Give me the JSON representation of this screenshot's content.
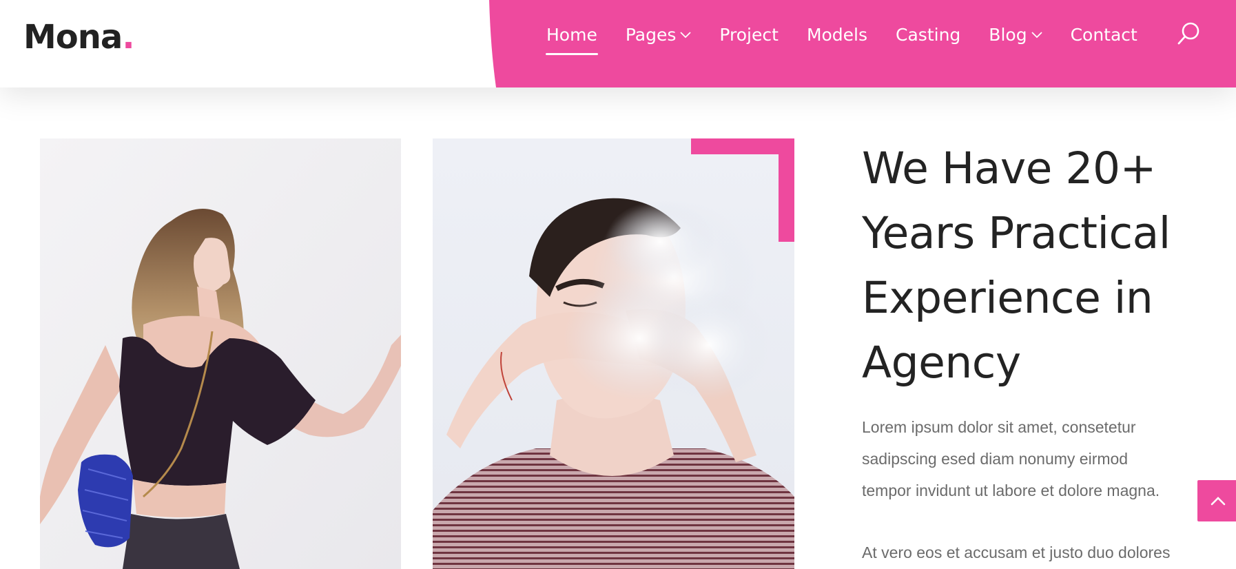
{
  "brand": {
    "name": "Mona",
    "dot": ".",
    "accent_color": "#ee4a9e"
  },
  "nav": {
    "items": [
      {
        "label": "Home",
        "active": true,
        "has_dropdown": false
      },
      {
        "label": "Pages",
        "active": false,
        "has_dropdown": true
      },
      {
        "label": "Project",
        "active": false,
        "has_dropdown": false
      },
      {
        "label": "Models",
        "active": false,
        "has_dropdown": false
      },
      {
        "label": "Casting",
        "active": false,
        "has_dropdown": false
      },
      {
        "label": "Blog",
        "active": false,
        "has_dropdown": true
      },
      {
        "label": "Contact",
        "active": false,
        "has_dropdown": false
      }
    ],
    "search_icon": "search-icon"
  },
  "about": {
    "heading_lines": [
      "We Have 20+",
      "Years Practical",
      "Experience in",
      "Agency"
    ],
    "paragraph_1_lines": [
      "Lorem ipsum dolor sit amet, consetetur",
      "sadipscing esed diam nonumy eirmod",
      "tempor invidunt ut labore et dolore magna."
    ],
    "paragraph_2": "At vero eos et accusam et justo duo dolores"
  },
  "images": {
    "left_photo": "female-model-photo",
    "right_photo": "male-model-smoke-photo"
  },
  "scroll_top": {
    "icon": "chevron-up-icon"
  }
}
